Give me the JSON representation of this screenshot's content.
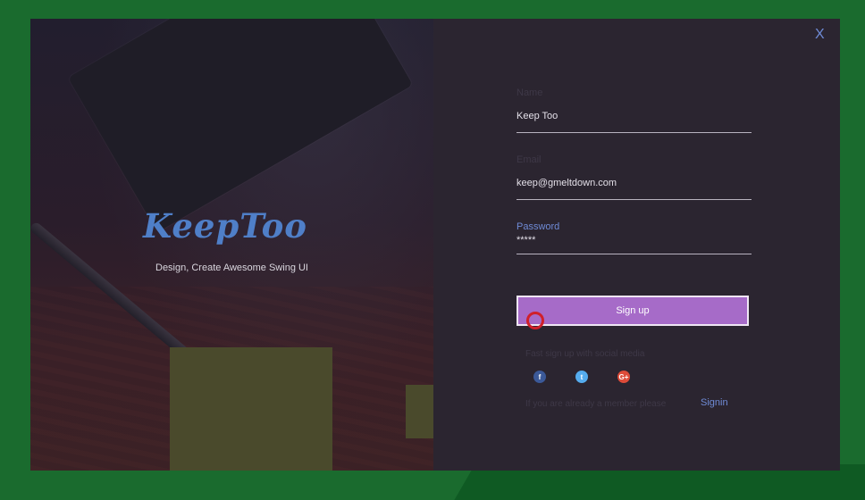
{
  "close_label": "X",
  "brand": {
    "logo": "KeepToo",
    "tagline": "Design, Create Awesome Swing UI"
  },
  "form": {
    "name": {
      "label": "Name",
      "value": "Keep Too"
    },
    "email": {
      "label": "Email",
      "value": "keep@gmeltdown.com"
    },
    "password": {
      "label": "Password",
      "value": "*****"
    },
    "signup_label": "Sign up"
  },
  "social": {
    "text": "Fast sign up with social media",
    "icons": [
      {
        "name": "facebook-icon",
        "glyph": "f",
        "color": "#3b5998"
      },
      {
        "name": "twitter-icon",
        "glyph": "t",
        "color": "#55acee"
      },
      {
        "name": "google-plus-icon",
        "glyph": "G+",
        "color": "#dd4b39"
      }
    ]
  },
  "footer": {
    "member_text": "If you are already a member please",
    "signin_label": "Signin"
  },
  "colors": {
    "accent": "#a66bc8",
    "link": "#6f8bd6",
    "panel": "#2b2530",
    "background": "#1a6b2e"
  }
}
